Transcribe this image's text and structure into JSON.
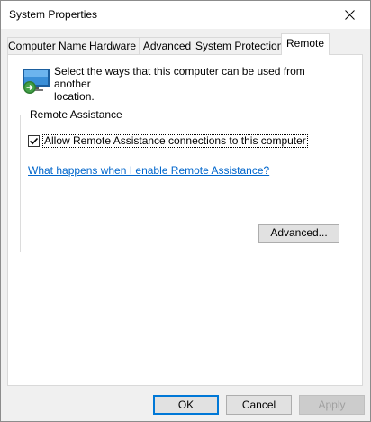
{
  "window": {
    "title": "System Properties"
  },
  "tabs": [
    {
      "label": "Computer Name"
    },
    {
      "label": "Hardware"
    },
    {
      "label": "Advanced"
    },
    {
      "label": "System Protection"
    },
    {
      "label": "Remote",
      "active": true
    }
  ],
  "remote": {
    "intro_line1": "Select the ways that this computer can be used from another",
    "intro_line2": "location.",
    "assistance": {
      "group_label": "Remote Assistance",
      "checkbox_label": "Allow Remote Assistance connections to this computer",
      "checked": true,
      "help_link": "What happens when I enable Remote Assistance?",
      "advanced_button": "Advanced..."
    }
  },
  "footer": {
    "ok_label": "OK",
    "cancel_label": "Cancel",
    "apply_label": "Apply"
  },
  "icons": {
    "close": "close-icon",
    "computer": "remote-computer-icon",
    "checkmark": "checkmark-icon"
  },
  "colors": {
    "link": "#0066cc",
    "ok_border": "#0078d7",
    "window_bg": "#f0f0f0",
    "panel_bg": "#ffffff"
  }
}
